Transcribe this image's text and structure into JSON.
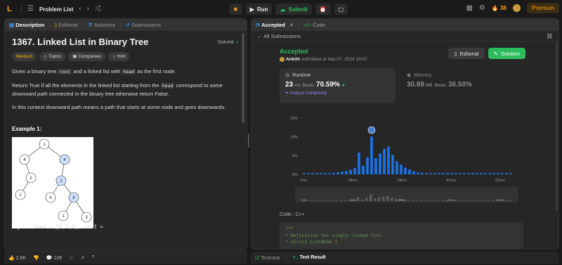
{
  "topbar": {
    "logo": "L",
    "problem_list": "Problem List",
    "run": "Run",
    "submit": "Submit",
    "streak": "38",
    "premium": "Premium"
  },
  "left_tabs": {
    "description": "Description",
    "editorial": "Editorial",
    "solutions": "Solutions",
    "submissions": "Submissions"
  },
  "problem": {
    "title": "1367. Linked List in Binary Tree",
    "status": "Solved",
    "difficulty": "Medium",
    "chips": [
      "Topics",
      "Companies",
      "Hint"
    ],
    "p1_a": "Given a binary tree ",
    "p1_code1": "root",
    "p1_b": " and a linked list with ",
    "p1_code2": "head",
    "p1_c": " as the first node.",
    "p2_a": "Return True if all the elements in the linked list starting from the ",
    "p2_code": "head",
    "p2_b": " correspond to some ",
    "p2_em": "downward path",
    "p2_c": " connected in the binary tree otherwise return False.",
    "p3": "In this context downward path means a path that starts at some node and goes downwards.",
    "example": "Example 1:",
    "input_label": "Input:",
    "input_value": " head = [4,2,8], root =",
    "tree_nodes": [
      "1",
      "4",
      "4",
      "2",
      "2",
      "1",
      "6",
      "8",
      "1",
      "3"
    ]
  },
  "left_footer": {
    "likes": "2.6K",
    "comments": "108"
  },
  "right_tabs": {
    "accepted": "Accepted",
    "code": "Code"
  },
  "submission": {
    "back": "All Submissions",
    "status": "Accepted",
    "user": "Ankith",
    "submitted": " submitted at Sep 07, 2024 19:07",
    "editorial_btn": "Editorial",
    "solution_btn": "Solution",
    "runtime_label": "Runtime",
    "runtime_value": "23",
    "runtime_unit": " ms",
    "runtime_beats_label": "Beats",
    "runtime_beats": "70.59%",
    "analyze": "Analyze Complexity",
    "memory_label": "Memory",
    "memory_value": "30.88",
    "memory_unit": " MB",
    "memory_beats_label": "Beats",
    "memory_beats": "36.50%"
  },
  "chart_data": {
    "type": "bar",
    "x_ticks": [
      "7ms",
      "18ms",
      "28ms",
      "41ms",
      "62ms"
    ],
    "y_ticks": [
      "0%",
      "5%",
      "10%",
      "15%"
    ],
    "ylim": [
      0,
      15
    ],
    "values": [
      0.3,
      0.3,
      0.3,
      0.3,
      0.3,
      0.3,
      0.3,
      0.4,
      0.5,
      0.7,
      0.9,
      1.2,
      1.7,
      5.8,
      2.3,
      4.5,
      10.1,
      4.3,
      5.6,
      6.8,
      7.4,
      5.2,
      3.5,
      2.6,
      1.8,
      1.3,
      0.8,
      0.5,
      0.4,
      0.3,
      0.3,
      0.3,
      0.3,
      0.3,
      0.3,
      0.3,
      0.3,
      0.3,
      0.3,
      0.3,
      0.3,
      0.3,
      0.3,
      0.3,
      0.3,
      0.3,
      0.3,
      0.3,
      0.3,
      0.3
    ],
    "highlight_color": "#1a73e8",
    "mini_ticks": [
      "7ms",
      "18ms",
      "28ms",
      "41ms",
      "62ms"
    ]
  },
  "code": {
    "header": "Code",
    "lang": "C++",
    "lines": [
      "/**",
      " * Definition for singly-linked list.",
      " * struct ListNode {"
    ]
  },
  "bottom": {
    "testcase": "Testcase",
    "result": "Test Result"
  }
}
